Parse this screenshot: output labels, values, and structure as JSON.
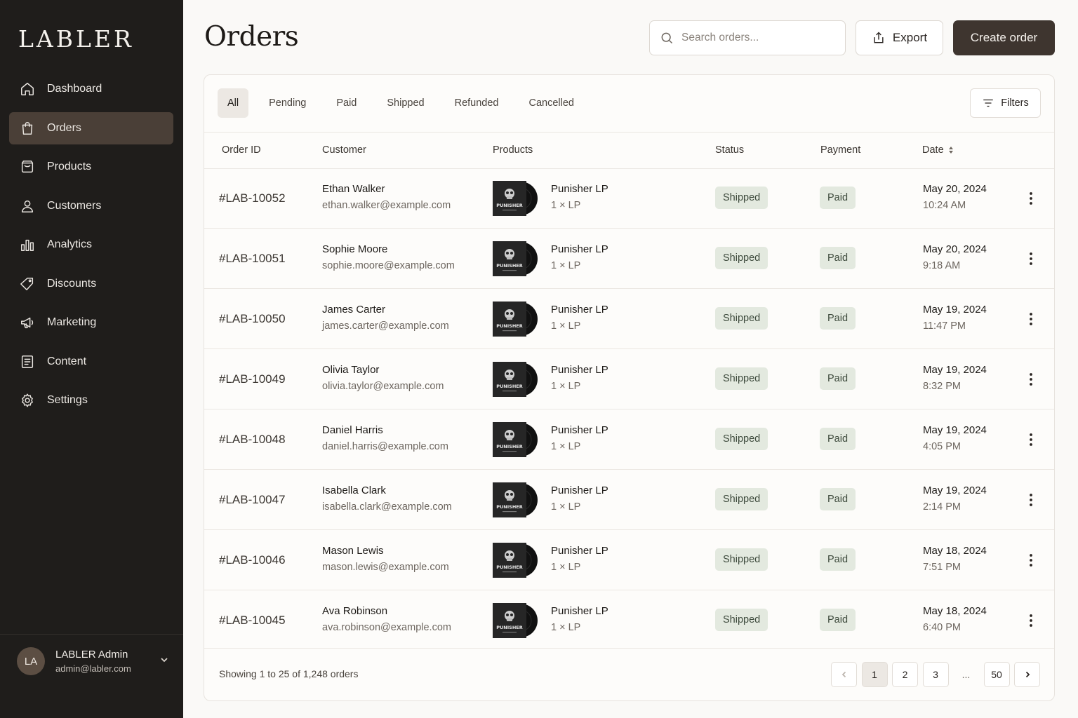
{
  "brand": {
    "logo": "LABLER"
  },
  "sidebar": {
    "items": [
      {
        "label": "Dashboard",
        "icon": "home-icon"
      },
      {
        "label": "Orders",
        "icon": "shopping-bag-icon",
        "active": true
      },
      {
        "label": "Products",
        "icon": "package-icon"
      },
      {
        "label": "Customers",
        "icon": "user-icon"
      },
      {
        "label": "Analytics",
        "icon": "bar-chart-icon"
      },
      {
        "label": "Discounts",
        "icon": "tag-icon"
      },
      {
        "label": "Marketing",
        "icon": "megaphone-icon"
      },
      {
        "label": "Content",
        "icon": "document-icon"
      },
      {
        "label": "Settings",
        "icon": "gear-icon"
      }
    ],
    "user": {
      "initials": "LA",
      "name": "LABLER Admin",
      "email": "admin@labler.com"
    }
  },
  "header": {
    "title": "Orders",
    "search_placeholder": "Search orders...",
    "export_label": "Export",
    "create_label": "Create order"
  },
  "tabs": [
    "All",
    "Pending",
    "Paid",
    "Shipped",
    "Refunded",
    "Cancelled"
  ],
  "active_tab": "All",
  "filters_label": "Filters",
  "table": {
    "columns": {
      "order_id": "Order ID",
      "customer": "Customer",
      "products": "Products",
      "status": "Status",
      "payment": "Payment",
      "date": "Date"
    },
    "rows": [
      {
        "id": "#LAB-10052",
        "name": "Ethan Walker",
        "email": "ethan.walker@example.com",
        "product": "Punisher LP",
        "qty": "1 × LP",
        "status": "Shipped",
        "payment": "Paid",
        "date": "May 20, 2024",
        "time": "10:24 AM"
      },
      {
        "id": "#LAB-10051",
        "name": "Sophie Moore",
        "email": "sophie.moore@example.com",
        "product": "Punisher LP",
        "qty": "1 × LP",
        "status": "Shipped",
        "payment": "Paid",
        "date": "May 20, 2024",
        "time": "9:18 AM"
      },
      {
        "id": "#LAB-10050",
        "name": "James Carter",
        "email": "james.carter@example.com",
        "product": "Punisher LP",
        "qty": "1 × LP",
        "status": "Shipped",
        "payment": "Paid",
        "date": "May 19, 2024",
        "time": "11:47 PM"
      },
      {
        "id": "#LAB-10049",
        "name": "Olivia Taylor",
        "email": "olivia.taylor@example.com",
        "product": "Punisher LP",
        "qty": "1 × LP",
        "status": "Shipped",
        "payment": "Paid",
        "date": "May 19, 2024",
        "time": "8:32 PM"
      },
      {
        "id": "#LAB-10048",
        "name": "Daniel Harris",
        "email": "daniel.harris@example.com",
        "product": "Punisher LP",
        "qty": "1 × LP",
        "status": "Shipped",
        "payment": "Paid",
        "date": "May 19, 2024",
        "time": "4:05 PM"
      },
      {
        "id": "#LAB-10047",
        "name": "Isabella Clark",
        "email": "isabella.clark@example.com",
        "product": "Punisher LP",
        "qty": "1 × LP",
        "status": "Shipped",
        "payment": "Paid",
        "date": "May 19, 2024",
        "time": "2:14 PM"
      },
      {
        "id": "#LAB-10046",
        "name": "Mason Lewis",
        "email": "mason.lewis@example.com",
        "product": "Punisher LP",
        "qty": "1 × LP",
        "status": "Shipped",
        "payment": "Paid",
        "date": "May 18, 2024",
        "time": "7:51 PM"
      },
      {
        "id": "#LAB-10045",
        "name": "Ava Robinson",
        "email": "ava.robinson@example.com",
        "product": "Punisher LP",
        "qty": "1 × LP",
        "status": "Shipped",
        "payment": "Paid",
        "date": "May 18, 2024",
        "time": "6:40 PM"
      }
    ]
  },
  "album_cover_text": "PUNISHER",
  "footer": {
    "showing": "Showing 1 to 25 of 1,248 orders",
    "pages": [
      "1",
      "2",
      "3",
      "...",
      "50"
    ],
    "current_page": "1"
  },
  "colors": {
    "sidebar_bg": "#1f1d1b",
    "active_nav": "#4a3f37",
    "primary_button": "#3e352f",
    "badge_bg": "#e3e9df"
  }
}
